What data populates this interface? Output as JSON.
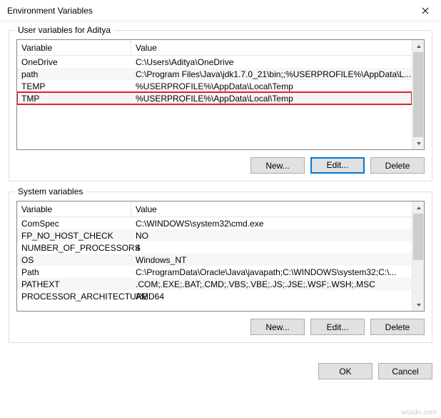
{
  "window": {
    "title": "Environment Variables"
  },
  "user_section": {
    "label": "User variables for Aditya",
    "col_variable": "Variable",
    "col_value": "Value",
    "rows": [
      {
        "name": "OneDrive",
        "value": "C:\\Users\\Aditya\\OneDrive"
      },
      {
        "name": "path",
        "value": "C:\\Program Files\\Java\\jdk1.7.0_21\\bin;;%USERPROFILE%\\AppData\\L..."
      },
      {
        "name": "TEMP",
        "value": "%USERPROFILE%\\AppData\\Local\\Temp"
      },
      {
        "name": "TMP",
        "value": "%USERPROFILE%\\AppData\\Local\\Temp"
      }
    ],
    "highlighted_index": 3,
    "buttons": {
      "new": "New...",
      "edit": "Edit...",
      "delete": "Delete"
    }
  },
  "system_section": {
    "label": "System variables",
    "col_variable": "Variable",
    "col_value": "Value",
    "rows": [
      {
        "name": "ComSpec",
        "value": "C:\\WINDOWS\\system32\\cmd.exe"
      },
      {
        "name": "FP_NO_HOST_CHECK",
        "value": "NO"
      },
      {
        "name": "NUMBER_OF_PROCESSORS",
        "value": "4"
      },
      {
        "name": "OS",
        "value": "Windows_NT"
      },
      {
        "name": "Path",
        "value": "C:\\ProgramData\\Oracle\\Java\\javapath;C:\\WINDOWS\\system32;C:\\..."
      },
      {
        "name": "PATHEXT",
        "value": ".COM;.EXE;.BAT;.CMD;.VBS;.VBE;.JS;.JSE;.WSF;.WSH;.MSC"
      },
      {
        "name": "PROCESSOR_ARCHITECTURE",
        "value": "AMD64"
      }
    ],
    "buttons": {
      "new": "New...",
      "edit": "Edit...",
      "delete": "Delete"
    }
  },
  "dialog_buttons": {
    "ok": "OK",
    "cancel": "Cancel"
  },
  "watermark": "wsxdn.com"
}
